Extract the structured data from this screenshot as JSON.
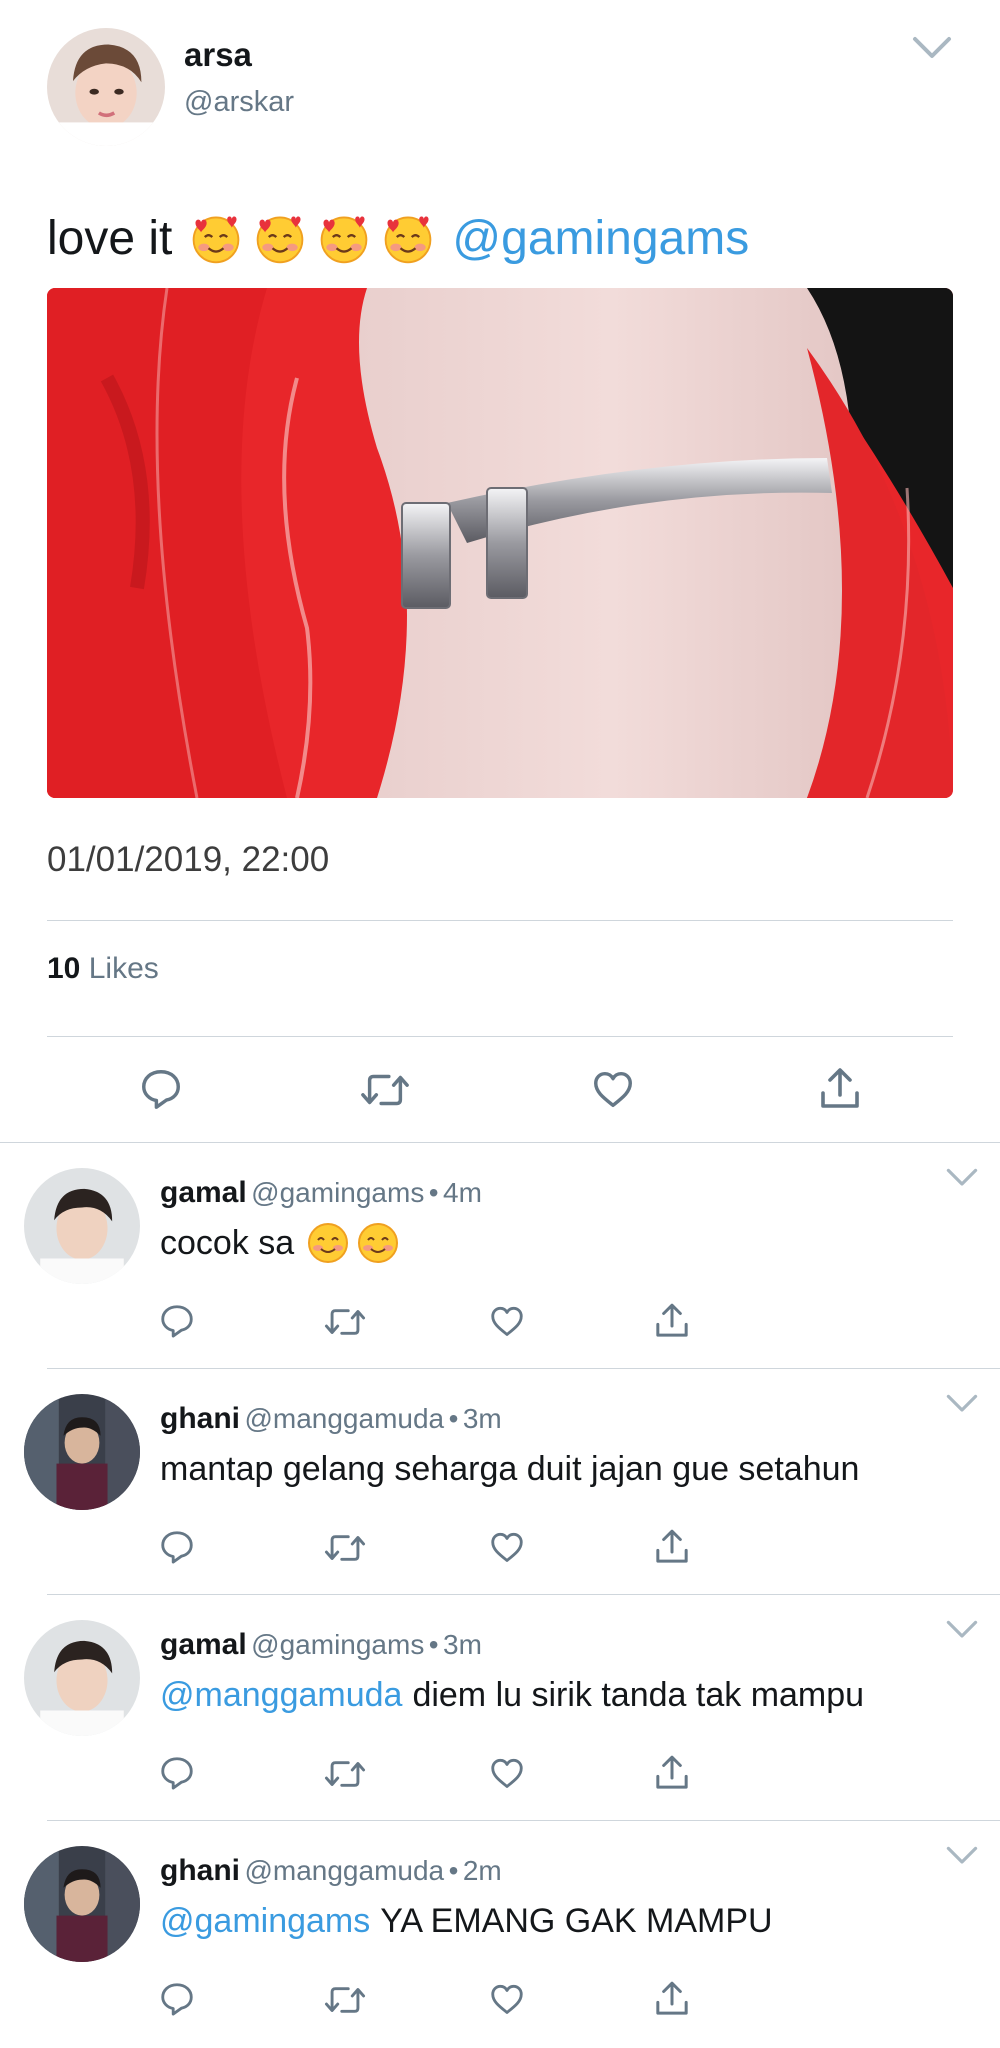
{
  "tweet": {
    "author_name": "arsa",
    "author_handle": "@arskar",
    "text": "love it",
    "emoji_count": 4,
    "emoji_name": "smiling-face-with-hearts",
    "mention": "@gamingams",
    "timestamp": "01/01/2019, 22:00",
    "likes_count": "10",
    "likes_label": "Likes"
  },
  "replies": [
    {
      "name": "gamal",
      "handle": "@gamingams",
      "separator": "•",
      "time": "4m",
      "mention": "",
      "text": "cocok sa",
      "emoji": "smiling-face-with-smiling-eyes"
    },
    {
      "name": "ghani",
      "handle": "@manggamuda",
      "separator": "•",
      "time": "3m",
      "mention": "",
      "text": "mantap gelang seharga duit jajan gue setahun",
      "emoji": ""
    },
    {
      "name": "gamal",
      "handle": "@gamingams",
      "separator": "•",
      "time": "3m",
      "mention": "@manggamuda",
      "text": "diem lu sirik tanda tak mampu",
      "emoji": ""
    },
    {
      "name": "ghani",
      "handle": "@manggamuda",
      "separator": "•",
      "time": "2m",
      "mention": "@gamingams",
      "text": "YA EMANG GAK MAMPU",
      "emoji": ""
    }
  ],
  "icons": {
    "reply": "reply-icon",
    "retweet": "retweet-icon",
    "like": "heart-icon",
    "share": "share-icon",
    "more": "chevron-down-icon"
  },
  "colors": {
    "mention": "#3a9be0",
    "secondary_text": "#657786",
    "divider": "#cfd6dc"
  }
}
